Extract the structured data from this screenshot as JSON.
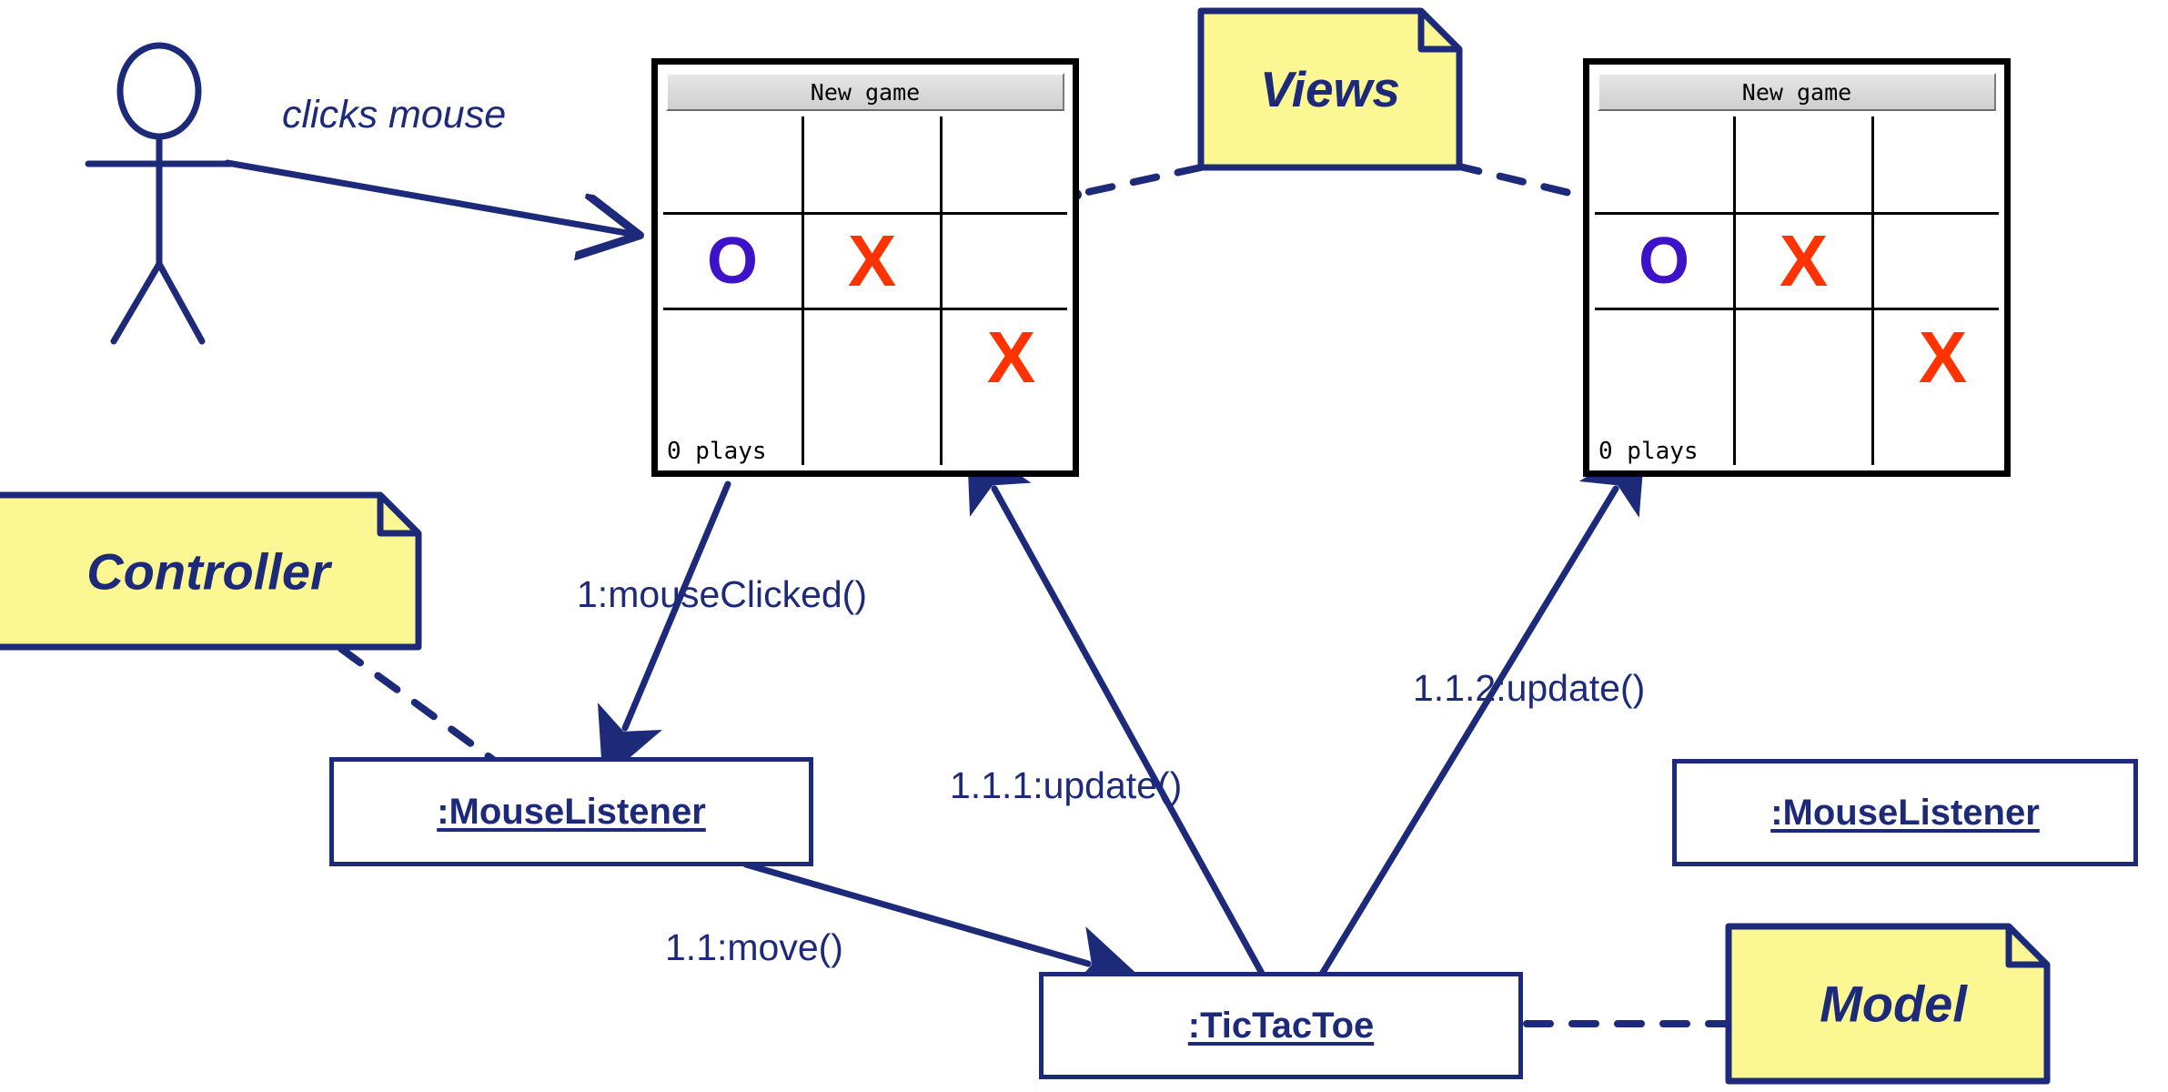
{
  "diagram": {
    "title": "MVC Tic Tac Toe UML Collaboration Diagram",
    "accent_color": "#1d2a7a",
    "note_fill": "#fbf894",
    "mark_o_color": "#3d12c8",
    "mark_x_color": "#ff3300"
  },
  "actor": {
    "name": "user-actor",
    "label": "clicks mouse"
  },
  "views": [
    {
      "id": "view-left",
      "button_label": "New game",
      "status_text": "0 plays",
      "cells": [
        "",
        "",
        "",
        "O",
        "X",
        "",
        "",
        "",
        "X"
      ]
    },
    {
      "id": "view-right",
      "button_label": "New game",
      "status_text": "0 plays",
      "cells": [
        "",
        "",
        "",
        "O",
        "X",
        "",
        "",
        "",
        "X"
      ]
    }
  ],
  "objects": [
    {
      "id": "mouselistener-left",
      "label": ":MouseListener"
    },
    {
      "id": "mouselistener-right",
      "label": ":MouseListener"
    },
    {
      "id": "tictactoe",
      "label": ":TicTacToe"
    }
  ],
  "notes": [
    {
      "id": "note-controller",
      "label": "Controller"
    },
    {
      "id": "note-views",
      "label": "Views"
    },
    {
      "id": "note-model",
      "label": "Model"
    }
  ],
  "messages": [
    {
      "id": "msg-1",
      "label": "1:mouseClicked()"
    },
    {
      "id": "msg-1-1",
      "label": "1.1:move()"
    },
    {
      "id": "msg-1-1-1",
      "label": "1.1.1:update()"
    },
    {
      "id": "msg-1-1-2",
      "label": "1.1.2:update()"
    }
  ]
}
